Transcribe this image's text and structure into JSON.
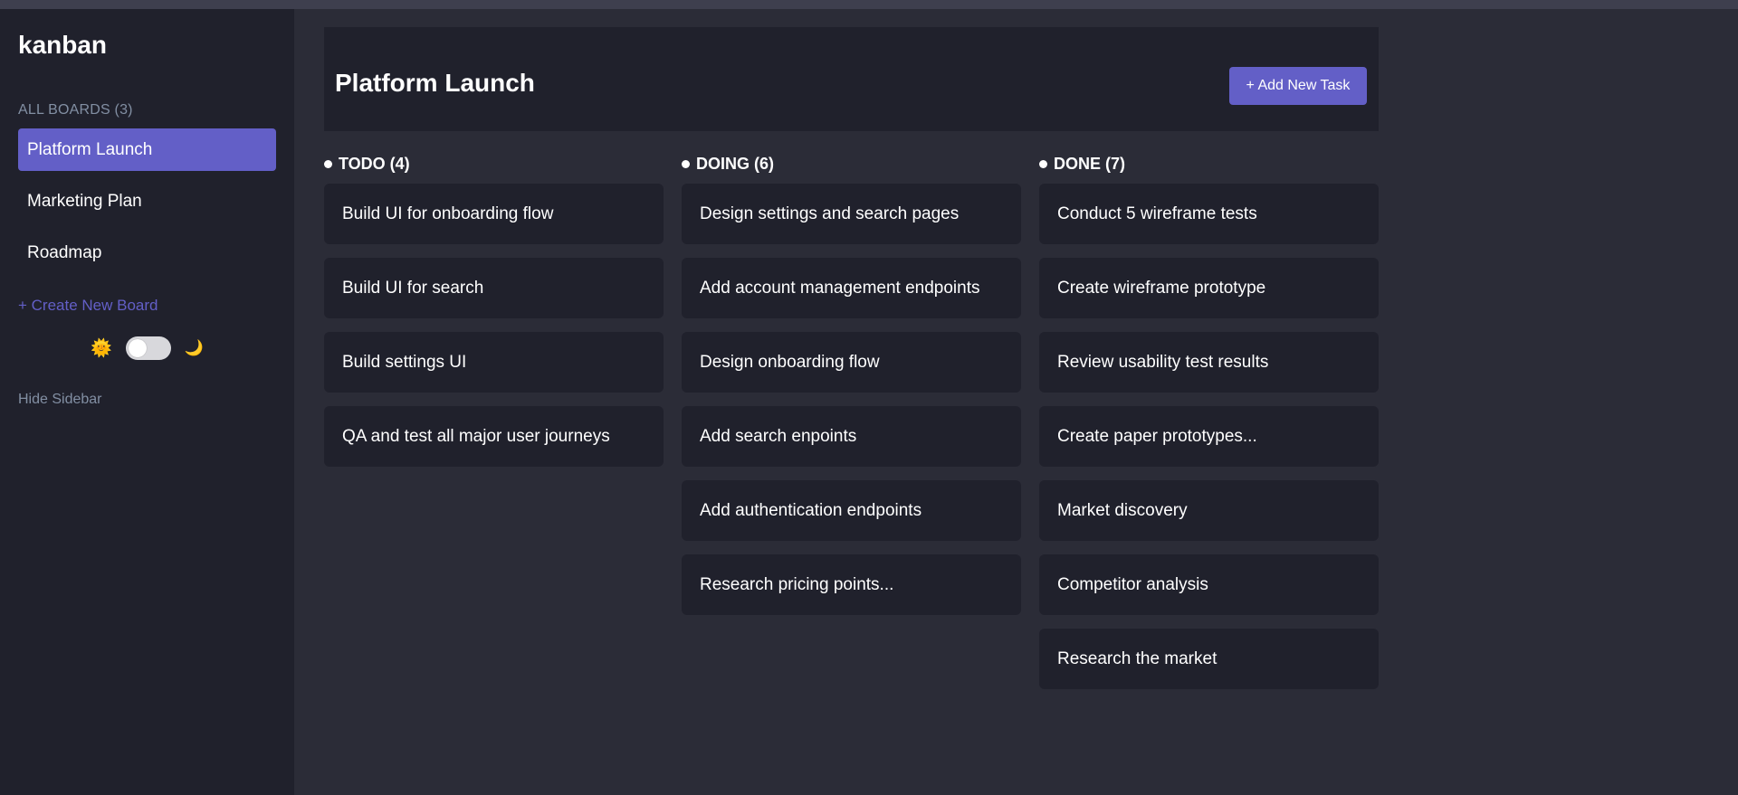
{
  "app": {
    "logo": "kanban"
  },
  "sidebar": {
    "boards_heading": "ALL BOARDS (3)",
    "boards": [
      {
        "label": "Platform Launch",
        "active": true
      },
      {
        "label": "Marketing Plan",
        "active": false
      },
      {
        "label": "Roadmap",
        "active": false
      }
    ],
    "create_board": "+ Create New Board",
    "theme_toggle": {
      "light_icon": "sun-icon",
      "dark_icon": "moon-icon",
      "state": "light"
    },
    "hide_sidebar": "Hide Sidebar"
  },
  "header": {
    "title": "Platform Launch",
    "add_task_label": "+ Add New Task"
  },
  "columns": [
    {
      "title": "TODO (4)",
      "tasks": [
        "Build UI for onboarding flow",
        "Build UI for search",
        "Build settings UI",
        "QA and test all major user journeys"
      ]
    },
    {
      "title": "DOING (6)",
      "tasks": [
        "Design settings and search pages",
        "Add account management endpoints",
        "Design onboarding flow",
        "Add search enpoints",
        "Add authentication endpoints",
        "Research pricing points..."
      ]
    },
    {
      "title": "DONE (7)",
      "tasks": [
        "Conduct 5 wireframe tests",
        "Create wireframe prototype",
        "Review usability test results",
        "Create paper prototypes...",
        "Market discovery",
        "Competitor analysis",
        "Research the market"
      ]
    }
  ],
  "colors": {
    "accent": "#635fc7",
    "sidebar_bg": "#20212c",
    "board_bg": "#2b2c37",
    "card_bg": "#20212c",
    "muted_text": "#828fa3"
  }
}
